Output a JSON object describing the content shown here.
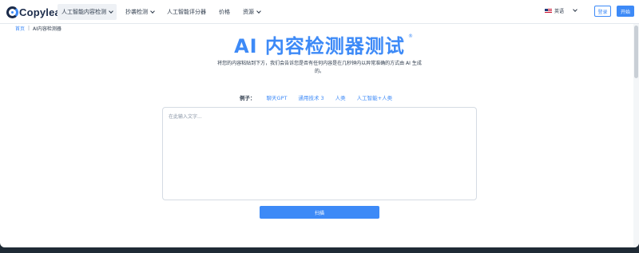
{
  "header": {
    "logo_text": "Copyleaks",
    "nav": [
      {
        "label": "人工智能内容检测",
        "has_chevron": true,
        "active": true
      },
      {
        "label": "抄袭检测",
        "has_chevron": true,
        "active": false
      },
      {
        "label": "人工智能评分器",
        "has_chevron": false,
        "active": false
      },
      {
        "label": "价格",
        "has_chevron": false,
        "active": false
      },
      {
        "label": "资源",
        "has_chevron": true,
        "active": false
      }
    ],
    "language": "英语",
    "login_label": "登录",
    "start_label": "开始"
  },
  "breadcrumb": {
    "home": "首页",
    "separator": "|",
    "current": "AI内容检测器"
  },
  "hero": {
    "title": "AI 内容检测器测试",
    "title_sup": "®",
    "subtitle": "将您的内容粘贴到下方，我们会告诉您是否有任何内容是在几秒钟内以异常准确的方式由 AI 生成的。"
  },
  "examples": {
    "label": "例子：",
    "items": [
      "聊天GPT",
      "通用技术 3",
      "人类",
      "人工智能+人类"
    ]
  },
  "input": {
    "placeholder": "在此输入文字...",
    "value": ""
  },
  "scan_label": "扫描",
  "colors": {
    "accent": "#3d8af7",
    "brand_dark": "#1b2b4a",
    "text": "#2d3a4b"
  }
}
